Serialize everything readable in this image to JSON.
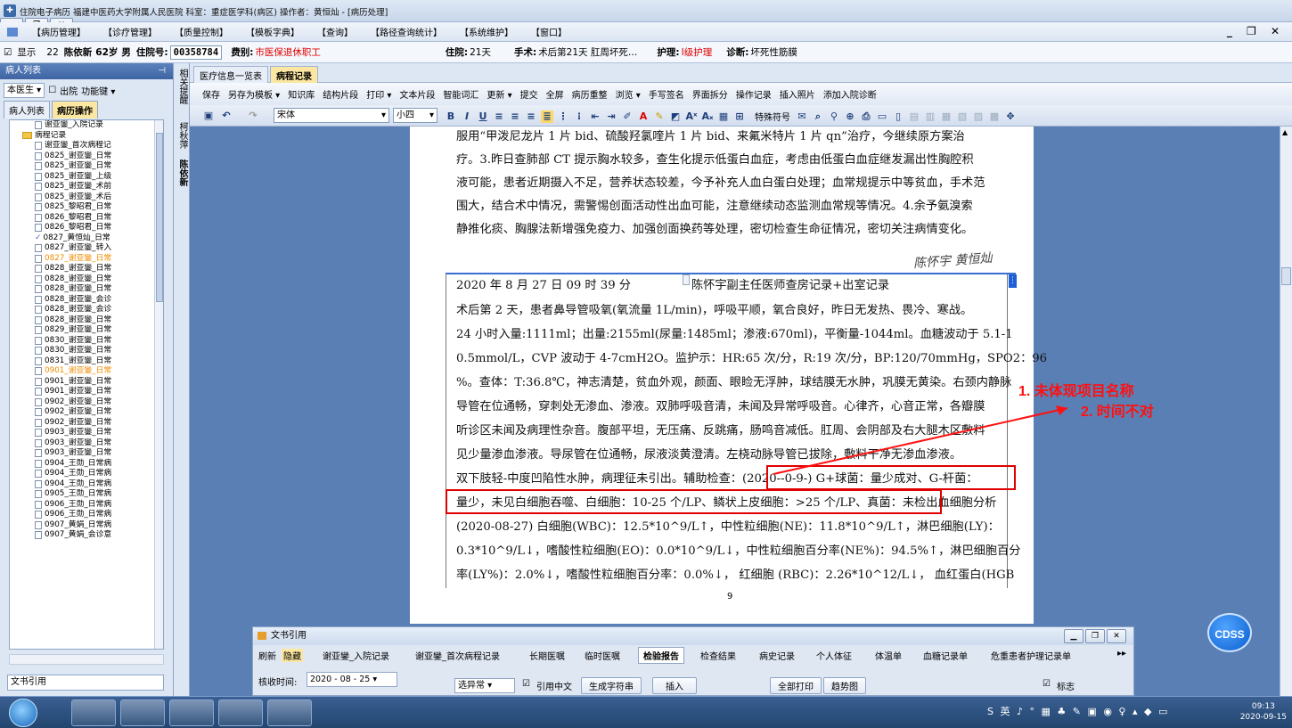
{
  "window": {
    "title": "住院电子病历  福建中医药大学附属人民医院  科室：重症医学科(病区)  操作者：黄恒灿 - [病历处理]"
  },
  "menu": [
    "【病历管理】",
    "【诊疗管理】",
    "【质量控制】",
    "【模板字典】",
    "【查询】",
    "【路径查询统计】",
    "【系统维护】",
    "【窗口】"
  ],
  "info": {
    "show_label": "显示",
    "bed": "22",
    "patient_name": "陈依新",
    "age": "62岁",
    "sex": "男",
    "admission_label": "住院号:",
    "admission_no": "00358784",
    "category_label": "费别:",
    "category": "市医保退休职工",
    "stay_label": "住院:",
    "stay": "21天",
    "surgery_label": "手术:",
    "surgery": "术后第21天  肛周坏死…",
    "nursing_label": "护理:",
    "nursing": "I级护理",
    "diagnosis_label": "诊断:",
    "diagnosis": "坏死性筋膜"
  },
  "left": {
    "header": "病人列表",
    "doctor_select": "本医生",
    "discharged": "出院",
    "func_key": "功能键",
    "tab_patients": "病人列表",
    "tab_records": "病历操作",
    "footer": "文书引用",
    "tree": [
      {
        "text": "谢亚鑾_入院记录",
        "type": "doc"
      },
      {
        "text": "病程记录",
        "type": "group"
      },
      {
        "text": "谢亚鑾_首次病程记",
        "type": "doc"
      },
      {
        "text": "0825_谢亚鑾_日常",
        "type": "doc"
      },
      {
        "text": "0825_谢亚鑾_日常",
        "type": "doc"
      },
      {
        "text": "0825_谢亚鑾_上级",
        "type": "doc"
      },
      {
        "text": "0825_谢亚鑾_术前",
        "type": "doc"
      },
      {
        "text": "0825_谢亚鑾_术后",
        "type": "doc"
      },
      {
        "text": "0825_黎昭君_日常",
        "type": "doc"
      },
      {
        "text": "0826_黎昭君_日常",
        "type": "doc"
      },
      {
        "text": "0826_黎昭君_日常",
        "type": "doc"
      },
      {
        "text": "0827_黄恒灿_日常",
        "type": "check"
      },
      {
        "text": "0827_谢亚鑾_转入",
        "type": "doc"
      },
      {
        "text": "0827_谢亚鑾_日常",
        "type": "hl"
      },
      {
        "text": "0828_谢亚鑾_日常",
        "type": "doc"
      },
      {
        "text": "0828_谢亚鑾_日常",
        "type": "doc"
      },
      {
        "text": "0828_谢亚鑾_日常",
        "type": "doc"
      },
      {
        "text": "0828_谢亚鑾_会诊",
        "type": "doc"
      },
      {
        "text": "0828_谢亚鑾_会诊",
        "type": "doc"
      },
      {
        "text": "0828_谢亚鑾_日常",
        "type": "doc"
      },
      {
        "text": "0829_谢亚鑾_日常",
        "type": "doc"
      },
      {
        "text": "0830_谢亚鑾_日常",
        "type": "doc"
      },
      {
        "text": "0830_谢亚鑾_日常",
        "type": "doc"
      },
      {
        "text": "0831_谢亚鑾_日常",
        "type": "doc"
      },
      {
        "text": "0901_谢亚鑾_日常",
        "type": "hl"
      },
      {
        "text": "0901_谢亚鑾_日常",
        "type": "doc"
      },
      {
        "text": "0901_谢亚鑾_日常",
        "type": "doc"
      },
      {
        "text": "0902_谢亚鑾_日常",
        "type": "doc"
      },
      {
        "text": "0902_谢亚鑾_日常",
        "type": "doc"
      },
      {
        "text": "0902_谢亚鑾_日常",
        "type": "doc"
      },
      {
        "text": "0903_谢亚鑾_日常",
        "type": "doc"
      },
      {
        "text": "0903_谢亚鑾_日常",
        "type": "doc"
      },
      {
        "text": "0903_谢亚鑾_日常",
        "type": "doc"
      },
      {
        "text": "0904_王勋_日常病",
        "type": "doc"
      },
      {
        "text": "0904_王勋_日常病",
        "type": "doc"
      },
      {
        "text": "0904_王勋_日常病",
        "type": "doc"
      },
      {
        "text": "0905_王勋_日常病",
        "type": "doc"
      },
      {
        "text": "0906_王勋_日常病",
        "type": "doc"
      },
      {
        "text": "0906_王勋_日常病",
        "type": "doc"
      },
      {
        "text": "0907_黄娟_日常病",
        "type": "doc"
      },
      {
        "text": "0907_黄娟_会诊意",
        "type": "doc"
      }
    ]
  },
  "side_labels": [
    "相关提醒",
    "柯秋萍",
    "陈依新"
  ],
  "doc_tabs": [
    "医疗信息一览表",
    "病程记录"
  ],
  "toolbar1": [
    "保存",
    "另存为模板 ▾",
    "知识库",
    "结构片段",
    "打印 ▾",
    "文本片段",
    "智能词汇",
    "更新 ▾",
    "提交",
    "全屏",
    "病历重整",
    "浏览 ▾",
    "手写签名",
    "界面拆分",
    "操作记录",
    "插入照片",
    "添加入院诊断"
  ],
  "toolbar2": {
    "font": "宋体",
    "size": "小四",
    "special": "特殊符号"
  },
  "document": {
    "lines_top": [
      "服用“甲泼尼龙片 1 片 bid、硫酸羟氯喹片 1 片 bid、来氟米特片 1 片 qn”治疗，今继续原方案治",
      "疗。3.昨日查肺部 CT 提示胸水较多，查生化提示低蛋白血症，考虑由低蛋白血症继发漏出性胸腔积",
      "液可能，患者近期摄入不足，营养状态较差，今予补充人血白蛋白处理；血常规提示中等贫血，手术范",
      "围大，结合术中情况，需警惕创面活动性出血可能，注意继续动态监测血常规等情况。4.余予氨溴索",
      "静推化痰、胸腺法新增强免疫力、加强创面换药等处理，密切检查生命征情况，密切关注病情变化。"
    ],
    "signature": "陈怀宇 黄恒灿",
    "record_time": "2020 年 8 月 27 日 09 时 39 分",
    "record_title": "陈怀宇副主任医师查房记录+出室记录",
    "lines_body": [
      "    术后第 2 天，患者鼻导管吸氧(氧流量 1L/min)，呼吸平顺，氧合良好，昨日无发热、畏冷、寒战。",
      "24 小时入量:1111ml；出量:2155ml(尿量:1485ml；渗液:670ml)，平衡量-1044ml。血糖波动于 5.1-1",
      "0.5mmol/L，CVP 波动于 4-7cmH2O。监护示：HR:65 次/分，R:19 次/分，BP:120/70mmHg，SPO2：96",
      "%。查体：T:36.8℃，神志清楚，贫血外观，颜面、眼睑无浮肿，球结膜无水肿，巩膜无黄染。右颈内静脉",
      "导管在位通畅，穿刺处无渗血、渗液。双肺呼吸音清，未闻及异常呼吸音。心律齐，心音正常，各瓣膜",
      "听诊区未闻及病理性杂音。腹部平坦，无压痛、反跳痛，肠鸣音减低。肛周、会阴部及右大腿木区敷料",
      "见少量渗血渗液。导尿管在位通畅，尿液淡黄澄清。左桡动脉导管已拔除，敷料干净无渗血渗液。",
      "双下肢轻-中度凹陷性水肿，病理征未引出。辅助检查：(2020--0-9-) G+球菌：量少成对、G-杆菌：",
      "量少，未见白细胞吞噬、白细胞：10-25 个/LP、鳞状上皮细胞：>25 个/LP、真菌：未检出血细胞分析",
      "(2020-08-27) 白细胞(WBC)：12.5*10^9/L↑，中性粒细胞(NE)：11.8*10^9/L↑，淋巴细胞(LY)：",
      "0.3*10^9/L↓，嗜酸性粒细胞(EO)：0.0*10^9/L↓，中性粒细胞百分率(NE%)：94.5%↑，淋巴细胞百分",
      "率(LY%)：2.0%↓，嗜酸性粒细胞百分率：0.0%↓， 红细胞 (RBC)：2.26*10^12/L↓， 血红蛋白(HGB"
    ],
    "page_number": "9"
  },
  "annotations": {
    "line1": "1. 未体现项目名称",
    "line2": "2. 时间不对"
  },
  "cdss": "CDSS",
  "ref_panel": {
    "title": "文书引用",
    "tabs": [
      "刷新",
      "隐藏",
      "谢亚鑾_入院记录",
      "谢亚鑾_首次病程记录",
      "长期医嘱",
      "临时医嘱",
      "检验报告",
      "检查结果",
      "病史记录",
      "个人体征",
      "体温单",
      "血糖记录单",
      "危重患者护理记录单",
      "▸▸"
    ],
    "active_tab": "检验报告",
    "check_time_label": "核收时间:",
    "check_time": "2020 - 08 - 25",
    "filter": "选异常",
    "cite_cn": "引用中文",
    "gen_string": "生成字符串",
    "insert": "插入",
    "print_all": "全部打印",
    "trend": "趋势图",
    "flag": "标志"
  },
  "taskbar": {
    "time": "09:13",
    "date": "2020-09-15",
    "tray": "S 英 ♪ ° ▦ ♣ ✎ ▣ ◉ ♀ ▴ ◆ ▭"
  }
}
